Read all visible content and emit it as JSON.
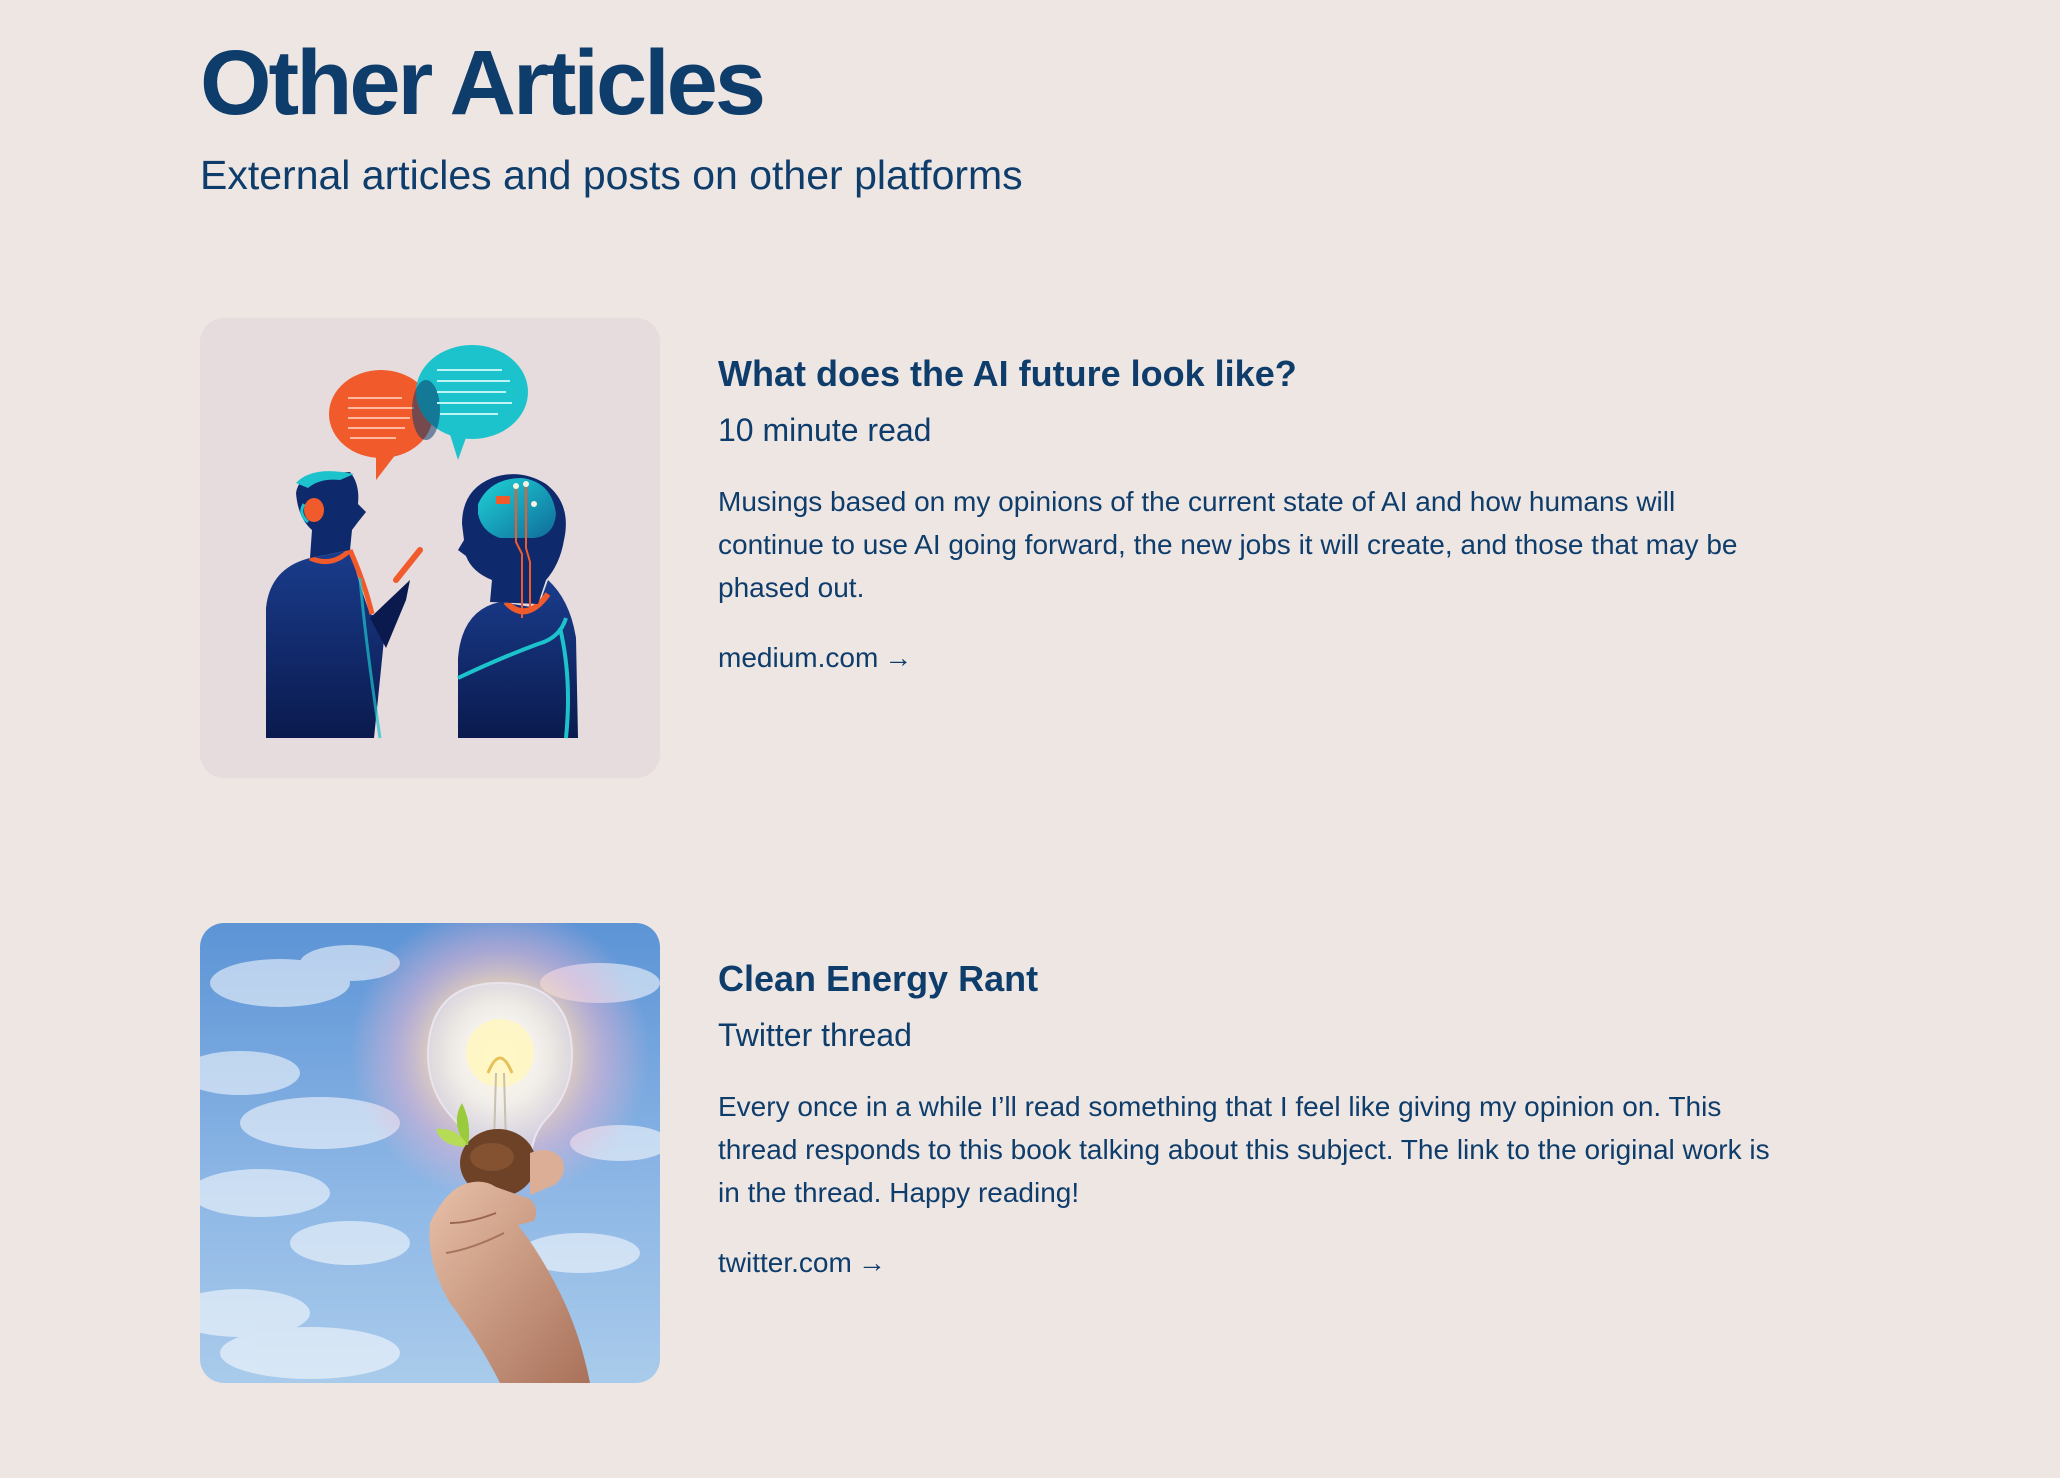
{
  "header": {
    "title": "Other Articles",
    "subtitle": "External articles and posts on other platforms"
  },
  "articles": [
    {
      "title": "What does the AI future look like?",
      "subtitle": "10 minute read",
      "description": "Musings based on my opinions of the current state of AI and how humans will continue to use AI going forward, the new jobs it will create, and those that may be phased out.",
      "link_label": "medium.com",
      "link_arrow": "→",
      "image_icon": "two-people-talking-illustration"
    },
    {
      "title": "Clean Energy Rant",
      "subtitle": "Twitter thread",
      "description": "Every once in a while I’ll read something that I feel like giving my opinion on. This thread responds to this book talking about this subject. The link to the original work is in the thread. Happy reading!",
      "link_label": "twitter.com",
      "link_arrow": "→",
      "image_icon": "hand-holding-lightbulb-photo"
    }
  ],
  "colors": {
    "background": "#EEE6E3",
    "text": "#0E3D6B",
    "accent_orange": "#F15A2B",
    "accent_teal": "#1CC3CC"
  }
}
